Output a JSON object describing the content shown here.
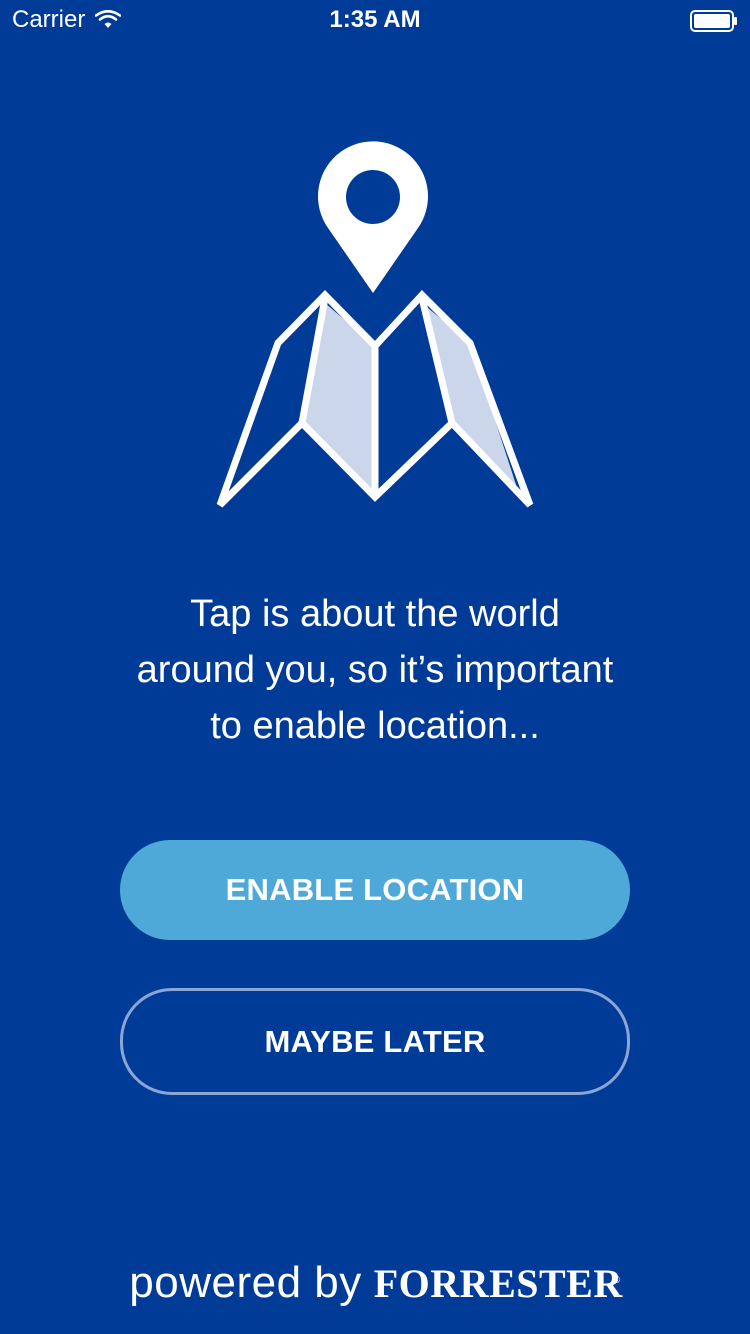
{
  "status_bar": {
    "carrier": "Carrier",
    "time": "1:35 AM",
    "icons": [
      "wifi-icon",
      "battery-icon"
    ]
  },
  "illustration": {
    "icon": "map-pin-icon",
    "colors": {
      "background": "#003b97",
      "stroke": "#ffffff",
      "panel_fill": "#ccd6ea"
    }
  },
  "message": "Tap is about the world\naround you, so it’s important\nto enable location...",
  "buttons": {
    "enable_label": "ENABLE LOCATION",
    "later_label": "MAYBE LATER",
    "enable_color": "#4fa9d8"
  },
  "footer": {
    "powered_by": "powered by",
    "brand": "FORRESTER",
    "registered": "®"
  }
}
